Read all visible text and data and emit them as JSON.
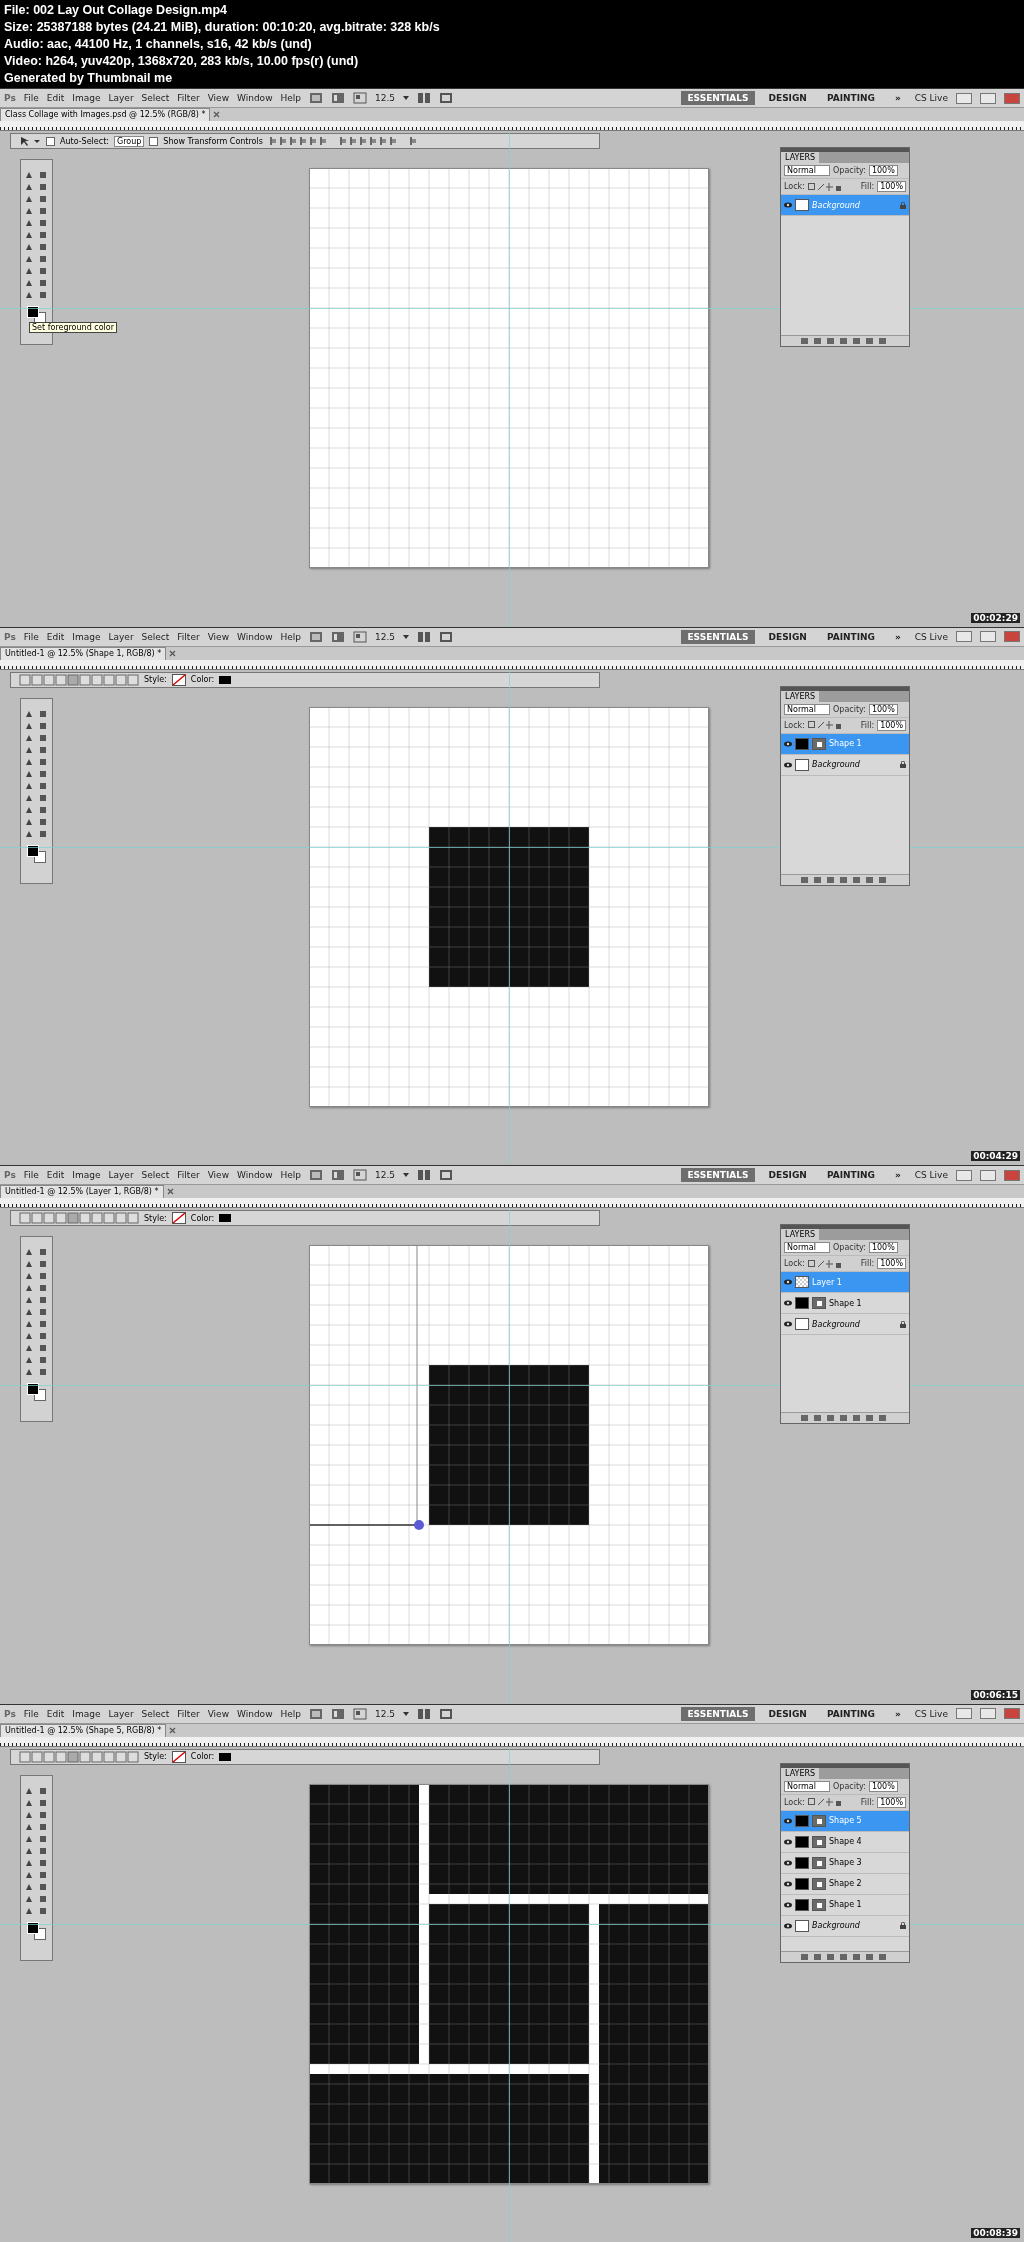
{
  "header": {
    "lines": [
      "File: 002 Lay Out Collage Design.mp4",
      "Size: 25387188 bytes (24.21 MiB), duration: 00:10:20, avg.bitrate: 328 kb/s",
      "Audio: aac, 44100 Hz, 1 channels, s16, 42 kb/s (und)",
      "Video: h264, yuv420p, 1368x720, 283 kb/s, 10.00 fps(r) (und)",
      "Generated by Thumbnail me"
    ]
  },
  "frames": [
    {
      "app_logo": "Ps",
      "menu": [
        "File",
        "Edit",
        "Image",
        "Layer",
        "Select",
        "Filter",
        "View",
        "Window",
        "Help"
      ],
      "zoom": "12.5",
      "workspaces": [
        {
          "label": "ESSENTIALS",
          "selected": true
        },
        {
          "label": "DESIGN",
          "selected": false
        },
        {
          "label": "PAINTING",
          "selected": false
        }
      ],
      "more": "»",
      "cs_live": "CS Live",
      "doc_tab": "Class Collage with Images.psd @ 12.5% (RGB/8) *",
      "options": {
        "kind": "move",
        "auto_select": {
          "label": "Auto-Select:",
          "checked": false
        },
        "group": "Group",
        "transform": {
          "label": "Show Transform Controls",
          "checked": false
        }
      },
      "tooltip": "Set foreground color",
      "canvas": {
        "kind": "blank"
      },
      "layers_panel": {
        "title": "LAYERS",
        "blend": "Normal",
        "opacity_label": "Opacity:",
        "opacity": "100%",
        "lock_label": "Lock:",
        "fill_label": "Fill:",
        "fill": "100%",
        "layers": [
          {
            "name": "Background",
            "selected": true,
            "kind": "background"
          }
        ]
      },
      "timestamp": "00:02:29"
    },
    {
      "app_logo": "Ps",
      "menu": [
        "File",
        "Edit",
        "Image",
        "Layer",
        "Select",
        "Filter",
        "View",
        "Window",
        "Help"
      ],
      "zoom": "12.5",
      "workspaces": [
        {
          "label": "ESSENTIALS",
          "selected": true
        },
        {
          "label": "DESIGN",
          "selected": false
        },
        {
          "label": "PAINTING",
          "selected": false
        }
      ],
      "more": "»",
      "cs_live": "CS Live",
      "doc_tab": "Untitled-1 @ 12.5% (Shape 1, RGB/8) *",
      "options": {
        "kind": "shape",
        "style": "Style:",
        "color_label": "Color:"
      },
      "canvas": {
        "kind": "square"
      },
      "layers_panel": {
        "title": "LAYERS",
        "blend": "Normal",
        "opacity_label": "Opacity:",
        "opacity": "100%",
        "lock_label": "Lock:",
        "fill_label": "Fill:",
        "fill": "100%",
        "layers": [
          {
            "name": "Shape 1",
            "selected": true,
            "kind": "shape"
          },
          {
            "name": "Background",
            "selected": false,
            "kind": "background"
          }
        ]
      },
      "timestamp": "00:04:29"
    },
    {
      "app_logo": "Ps",
      "menu": [
        "File",
        "Edit",
        "Image",
        "Layer",
        "Select",
        "Filter",
        "View",
        "Window",
        "Help"
      ],
      "zoom": "12.5",
      "workspaces": [
        {
          "label": "ESSENTIALS",
          "selected": true
        },
        {
          "label": "DESIGN",
          "selected": false
        },
        {
          "label": "PAINTING",
          "selected": false
        }
      ],
      "more": "»",
      "cs_live": "CS Live",
      "doc_tab": "Untitled-1 @ 12.5% (Layer 1, RGB/8) *",
      "options": {
        "kind": "shape",
        "style": "Style:",
        "color_label": "Color:"
      },
      "canvas": {
        "kind": "square-path"
      },
      "layers_panel": {
        "title": "LAYERS",
        "blend": "Normal",
        "opacity_label": "Opacity:",
        "opacity": "100%",
        "lock_label": "Lock:",
        "fill_label": "Fill:",
        "fill": "100%",
        "layers": [
          {
            "name": "Layer 1",
            "selected": true,
            "kind": "pixel"
          },
          {
            "name": "Shape 1",
            "selected": false,
            "kind": "shape"
          },
          {
            "name": "Background",
            "selected": false,
            "kind": "background"
          }
        ]
      },
      "timestamp": "00:06:15"
    },
    {
      "app_logo": "Ps",
      "menu": [
        "File",
        "Edit",
        "Image",
        "Layer",
        "Select",
        "Filter",
        "View",
        "Window",
        "Help"
      ],
      "zoom": "12.5",
      "workspaces": [
        {
          "label": "ESSENTIALS",
          "selected": true
        },
        {
          "label": "DESIGN",
          "selected": false
        },
        {
          "label": "PAINTING",
          "selected": false
        }
      ],
      "more": "»",
      "cs_live": "CS Live",
      "doc_tab": "Untitled-1 @ 12.5% (Shape 5, RGB/8) *",
      "options": {
        "kind": "shape",
        "style": "Style:",
        "color_label": "Color:"
      },
      "canvas": {
        "kind": "collage"
      },
      "layers_panel": {
        "title": "LAYERS",
        "blend": "Normal",
        "opacity_label": "Opacity:",
        "opacity": "100%",
        "lock_label": "Lock:",
        "fill_label": "Fill:",
        "fill": "100%",
        "layers": [
          {
            "name": "Shape 5",
            "selected": true,
            "kind": "shape"
          },
          {
            "name": "Shape 4",
            "selected": false,
            "kind": "shape"
          },
          {
            "name": "Shape 3",
            "selected": false,
            "kind": "shape"
          },
          {
            "name": "Shape 2",
            "selected": false,
            "kind": "shape"
          },
          {
            "name": "Shape 1",
            "selected": false,
            "kind": "shape"
          },
          {
            "name": "Background",
            "selected": false,
            "kind": "background"
          }
        ]
      },
      "timestamp": "00:08:39"
    }
  ]
}
